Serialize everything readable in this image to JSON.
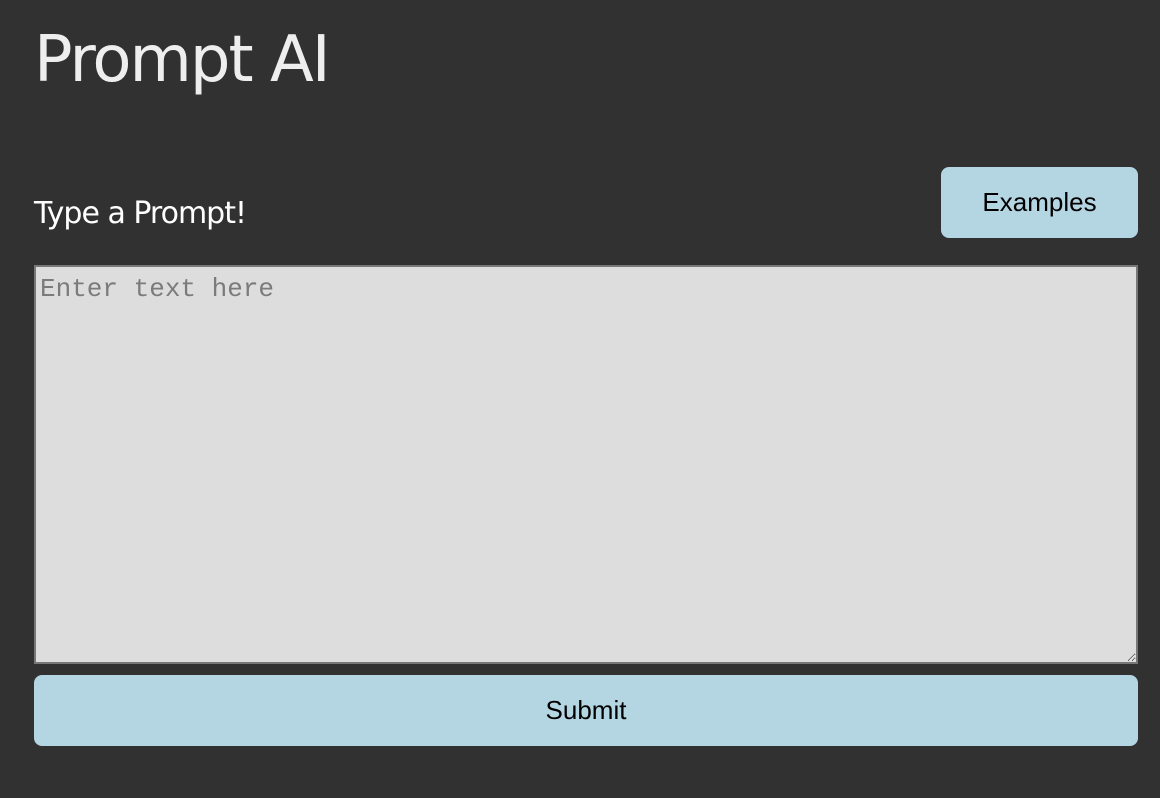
{
  "header": {
    "title": "Prompt AI"
  },
  "prompt": {
    "label": "Type a Prompt!",
    "examples_label": "Examples",
    "placeholder": "Enter text here",
    "value": "",
    "submit_label": "Submit"
  },
  "colors": {
    "background": "#313131",
    "button": "#b4d5e2",
    "textarea": "#dddddd"
  }
}
